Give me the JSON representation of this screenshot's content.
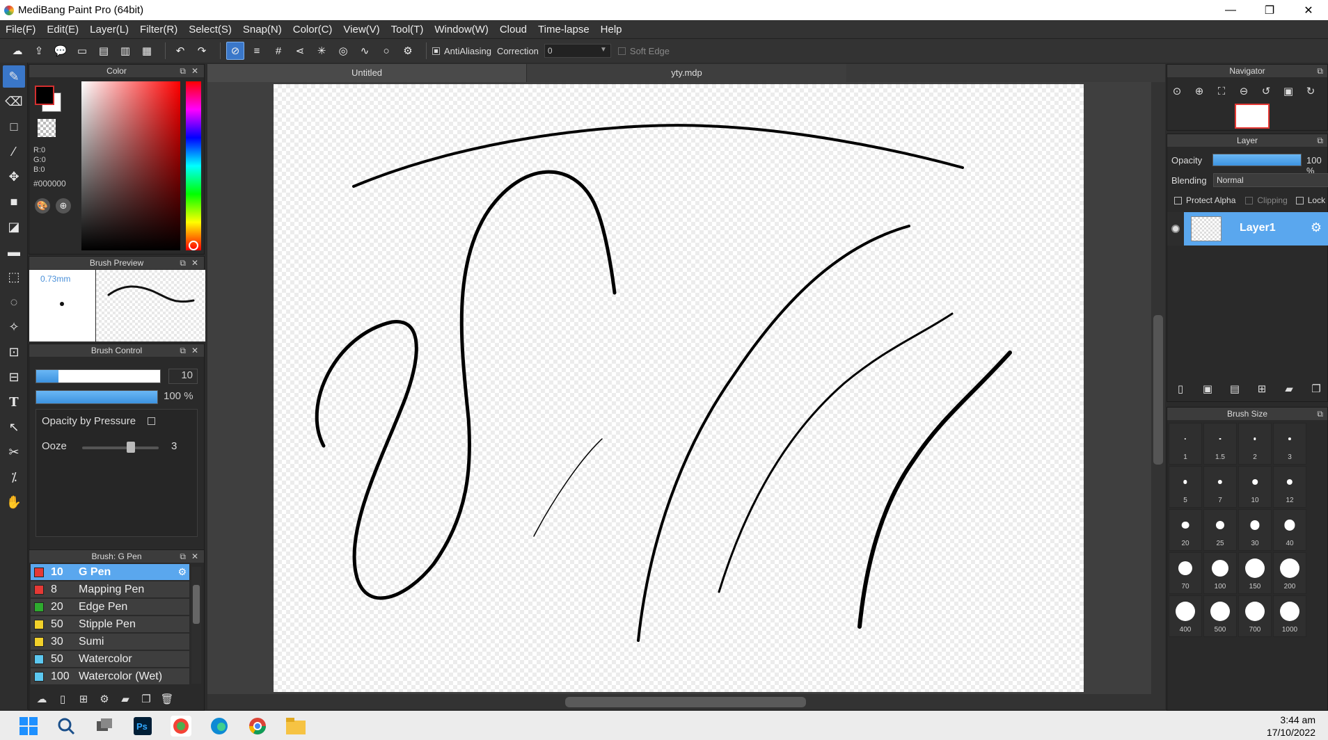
{
  "window": {
    "title": "MediBang Paint Pro (64bit)",
    "minimize": "—",
    "restore": "❐",
    "close": "✕"
  },
  "menu": [
    "File(F)",
    "Edit(E)",
    "Layer(L)",
    "Filter(R)",
    "Select(S)",
    "Snap(N)",
    "Color(C)",
    "View(V)",
    "Tool(T)",
    "Window(W)",
    "Cloud",
    "Time-lapse",
    "Help"
  ],
  "toolbar": {
    "antialiasing_label": "AntiAliasing",
    "correction_label": "Correction",
    "correction_value": "0",
    "soft_edge_label": "Soft Edge"
  },
  "color_panel": {
    "title": "Color",
    "r": "R:0",
    "g": "G:0",
    "b": "B:0",
    "hex": "#000000",
    "foreground": "#000000",
    "background": "#ffffff"
  },
  "brush_preview": {
    "title": "Brush Preview",
    "size": "0.73mm"
  },
  "brush_control": {
    "title": "Brush Control",
    "size_value": "10",
    "size_fraction": 0.18,
    "opacity_value": "100 %",
    "opacity_fraction": 1.0,
    "opacity_by_pressure": "Opacity by Pressure",
    "ooze_label": "Ooze",
    "ooze_value": "3"
  },
  "brush_list": {
    "title": "Brush: G Pen",
    "items": [
      {
        "size": "10",
        "name": "G Pen",
        "color": "#e53935",
        "selected": true
      },
      {
        "size": "8",
        "name": "Mapping Pen",
        "color": "#e53935"
      },
      {
        "size": "20",
        "name": "Edge Pen",
        "color": "#2eaa2e"
      },
      {
        "size": "50",
        "name": "Stipple Pen",
        "color": "#f2d12a"
      },
      {
        "size": "30",
        "name": "Sumi",
        "color": "#f2d12a"
      },
      {
        "size": "50",
        "name": "Watercolor",
        "color": "#5cc8f0"
      },
      {
        "size": "100",
        "name": "Watercolor (Wet)",
        "color": "#5cc8f0"
      }
    ]
  },
  "tabs": [
    "Untitled",
    "yty.mdp"
  ],
  "navigator": {
    "title": "Navigator"
  },
  "layer": {
    "title": "Layer",
    "opacity_label": "Opacity",
    "opacity_value": "100 %",
    "blending_label": "Blending",
    "blending_value": "Normal",
    "protect_alpha": "Protect Alpha",
    "clipping": "Clipping",
    "lock": "Lock",
    "layer_name": "Layer1"
  },
  "brush_size": {
    "title": "Brush Size",
    "sizes": [
      "1",
      "1.5",
      "2",
      "3",
      "5",
      "7",
      "10",
      "12",
      "20",
      "25",
      "30",
      "40",
      "70",
      "100",
      "150",
      "200",
      "400",
      "500",
      "700",
      "1000"
    ]
  },
  "taskbar": {
    "time": "3:44 am",
    "date": "17/10/2022"
  }
}
